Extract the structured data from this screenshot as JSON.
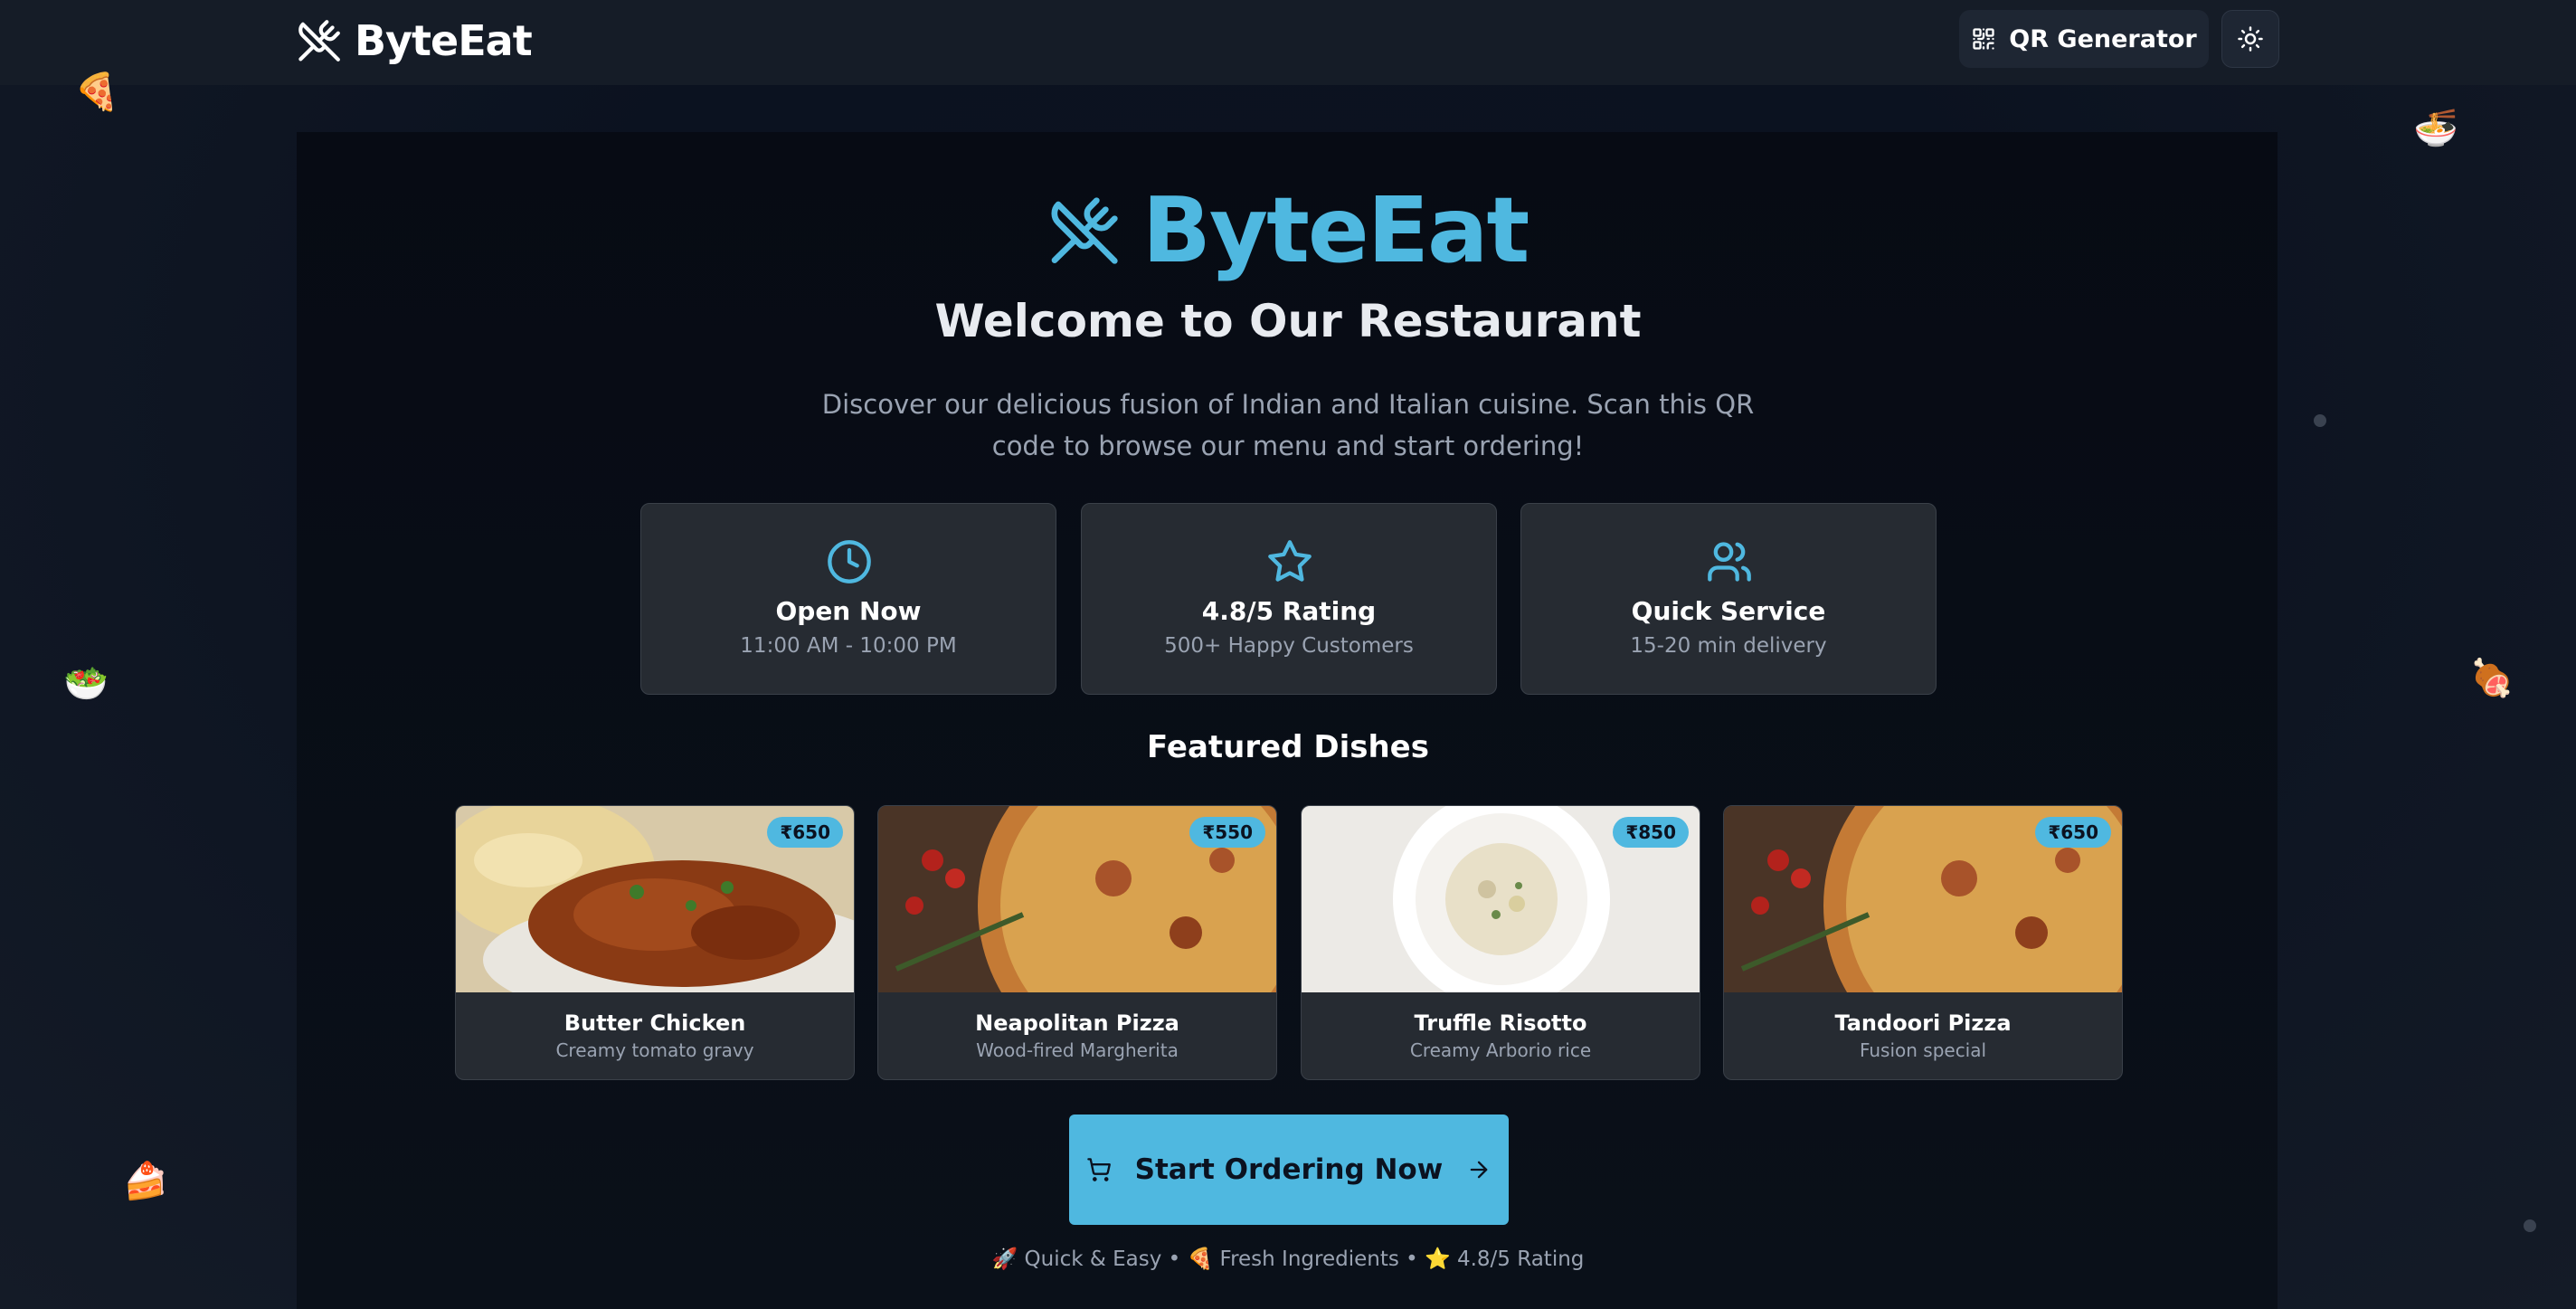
{
  "header": {
    "brand": "ByteEat",
    "qr_button_label": "QR Generator",
    "icons": [
      "utensils-crossed-icon",
      "qr-code-icon",
      "sun-icon"
    ]
  },
  "hero": {
    "brand": "ByteEat",
    "title": "Welcome to Our Restaurant",
    "intro": "Discover our delicious fusion of Indian and Italian cuisine. Scan this QR code to browse our menu and start ordering!"
  },
  "info_cards": [
    {
      "icon": "clock-icon",
      "title": "Open Now",
      "subtitle": "11:00 AM - 10:00 PM"
    },
    {
      "icon": "star-icon",
      "title": "4.8/5 Rating",
      "subtitle": "500+ Happy Customers"
    },
    {
      "icon": "users-icon",
      "title": "Quick Service",
      "subtitle": "15-20 min delivery"
    }
  ],
  "featured": {
    "heading": "Featured Dishes",
    "dishes": [
      {
        "name": "Butter Chicken",
        "description": "Creamy tomato gravy",
        "price": "₹650"
      },
      {
        "name": "Neapolitan Pizza",
        "description": "Wood-fired Margherita",
        "price": "₹550"
      },
      {
        "name": "Truffle Risotto",
        "description": "Creamy Arborio rice",
        "price": "₹850"
      },
      {
        "name": "Tandoori Pizza",
        "description": "Fusion special",
        "price": "₹650"
      }
    ]
  },
  "cta": {
    "label": "Start Ordering Now"
  },
  "footer_line": "🚀 Quick & Easy • 🍕 Fresh Ingredients • ⭐ 4.8/5 Rating",
  "floating_emojis": [
    "🍕",
    "🍜",
    "🥗",
    "🍖",
    "🍰"
  ],
  "colors": {
    "accent": "#4fb8e0",
    "background": "#0e1522",
    "card": "#262b32"
  }
}
